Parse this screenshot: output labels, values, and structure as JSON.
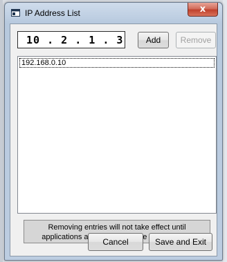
{
  "window": {
    "title": "IP Address List",
    "close_label": "x"
  },
  "ip_input": {
    "value": "10 . 2 . 1 . 3"
  },
  "buttons": {
    "add": "Add",
    "remove": "Remove",
    "cancel": "Cancel",
    "save_exit": "Save and Exit"
  },
  "list": {
    "items": [
      "192.168.0.10"
    ]
  },
  "notice": {
    "line1": "Removing entries will not take effect until",
    "line2": "applications and AvpBackplane are restarted"
  },
  "icons": {
    "app": "window-app-icon",
    "close": "close-icon"
  },
  "colors": {
    "close_button": "#c0412c",
    "dialog_bg": "#f0f0f0",
    "disabled_text": "#a0a0a0"
  }
}
